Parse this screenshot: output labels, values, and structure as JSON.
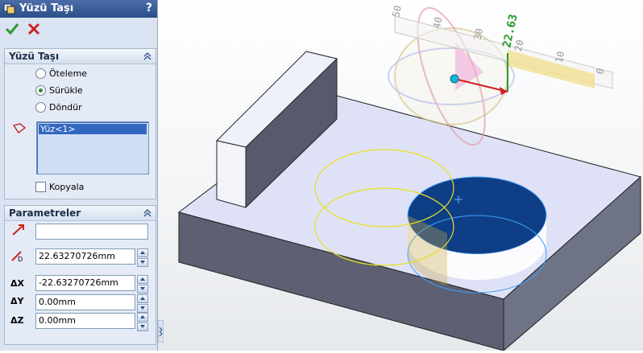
{
  "title": "Yüzü Taşı",
  "help": "?",
  "move_face_group": {
    "header": "Yüzü Taşı",
    "options": [
      {
        "label": "Öteleme",
        "selected": false
      },
      {
        "label": "Sürükle",
        "selected": true
      },
      {
        "label": "Döndür",
        "selected": false
      }
    ],
    "faces": [
      "Yüz<1>"
    ],
    "copy_label": "Kopyala",
    "copy_checked": false
  },
  "params_group": {
    "header": "Parametreler",
    "direction_value": "",
    "distance_value": "22.63270726mm",
    "dx_label": "X",
    "dx_value": "-22.63270726mm",
    "dy_label": "Y",
    "dy_value": "0.00mm",
    "dz_label": "Z",
    "dz_value": "0.00mm"
  },
  "ruler": {
    "readout": "22.63",
    "ticks": [
      "50",
      "40",
      "30",
      "20",
      "10",
      "0"
    ]
  },
  "colors": {
    "accent": "#2c4f8a",
    "ok": "#2a9a2a",
    "cancel": "#d02020",
    "part": "#dfe2f6",
    "hole": "#0a3a7a"
  }
}
